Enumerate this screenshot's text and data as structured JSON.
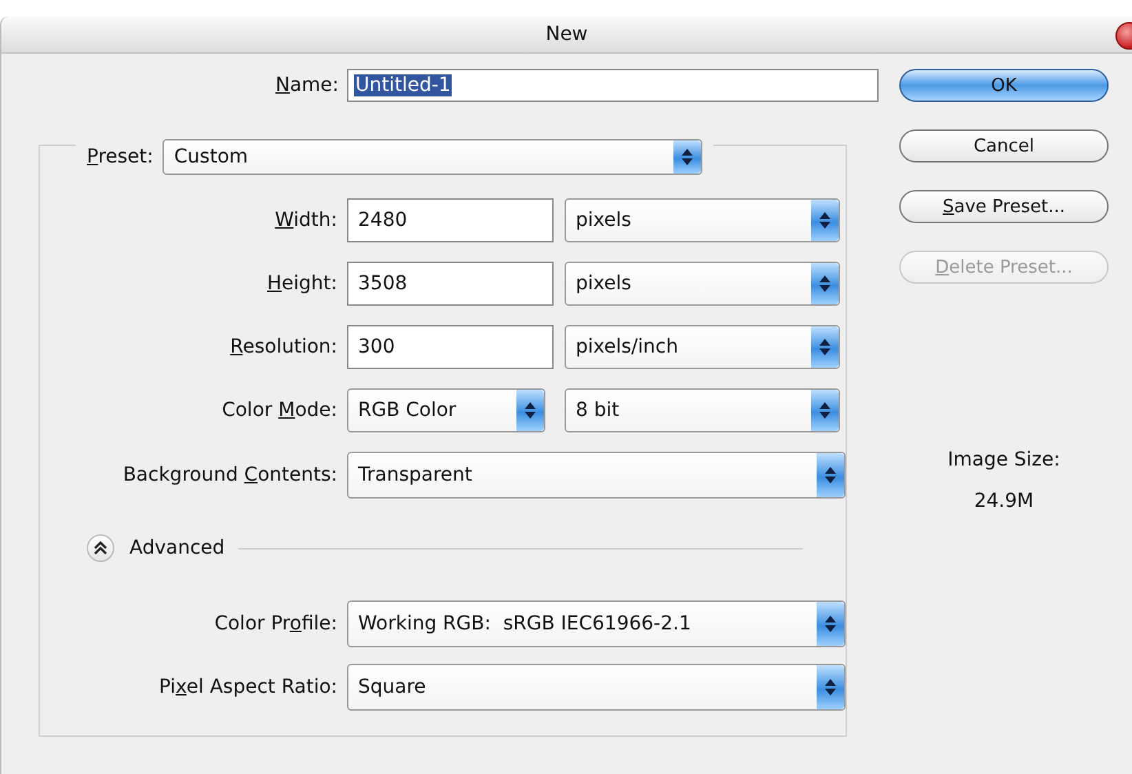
{
  "window": {
    "title": "New"
  },
  "name": {
    "label": {
      "key": "N",
      "post": "ame:"
    },
    "value": "Untitled-1",
    "text_selected": true
  },
  "preset": {
    "label": {
      "key": "P",
      "post": "reset:"
    },
    "value": "Custom"
  },
  "fields": [
    {
      "kind": "input",
      "label": {
        "key": "W",
        "post": "idth:"
      },
      "value": "2480",
      "unit": "pixels"
    },
    {
      "kind": "input",
      "label": {
        "key": "H",
        "post": "eight:"
      },
      "value": "3508",
      "unit": "pixels"
    },
    {
      "kind": "input",
      "label": {
        "key": "R",
        "post": "esolution:"
      },
      "value": "300",
      "unit": "pixels/inch"
    },
    {
      "kind": "select",
      "label": {
        "pre": "Color ",
        "key": "M",
        "post": "ode:"
      },
      "value": "RGB Color",
      "unit": "8 bit"
    },
    {
      "kind": "wide-select",
      "label": {
        "pre": "Background ",
        "key": "C",
        "post": "ontents:"
      },
      "value": "Transparent"
    }
  ],
  "advanced": {
    "label": "Advanced",
    "expanded": true
  },
  "advanced_fields": [
    {
      "kind": "wide-select",
      "label": {
        "pre": "Color Pr",
        "key": "o",
        "post": "file:"
      },
      "value": "Working RGB:  sRGB IEC61966-2.1"
    },
    {
      "kind": "wide-select",
      "label": {
        "pre": "Pi",
        "key": "x",
        "post": "el Aspect Ratio:"
      },
      "value": "Square"
    }
  ],
  "buttons": [
    {
      "label": {
        "post": "OK"
      },
      "default": true,
      "disabled": false
    },
    {
      "label": {
        "post": "Cancel"
      },
      "default": false,
      "disabled": false
    },
    {
      "label": {
        "key": "S",
        "post": "ave Preset..."
      },
      "default": false,
      "disabled": false
    },
    {
      "label": {
        "key": "D",
        "post": "elete Preset..."
      },
      "default": false,
      "disabled": true
    }
  ],
  "image_size": {
    "label": "Image Size:",
    "value": "24.9M"
  }
}
